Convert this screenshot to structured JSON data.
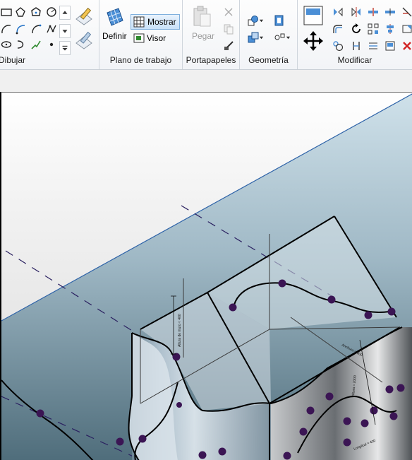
{
  "ribbon": {
    "groups": {
      "dibujar": "Dibujar",
      "plano": "Plano de trabajo",
      "portapapeles": "Portapapeles",
      "geometria": "Geometría",
      "modificar": "Modificar"
    },
    "buttons": {
      "definir": "Definir",
      "mostrar": "Mostrar",
      "visor": "Visor",
      "pegar": "Pegar"
    }
  },
  "viewport": {
    "dims": {
      "left_vertical": "Altura de muro ≈ 400",
      "right_horizontal": "Anchura ≈ 300",
      "right_vertical": "Altura ≈ 2000",
      "bottom": "Longitud ≈ 400"
    }
  },
  "colors": {
    "accent": "#1f6fc5",
    "selection_bg": "#c8e1f8",
    "node": "#3b1554"
  }
}
